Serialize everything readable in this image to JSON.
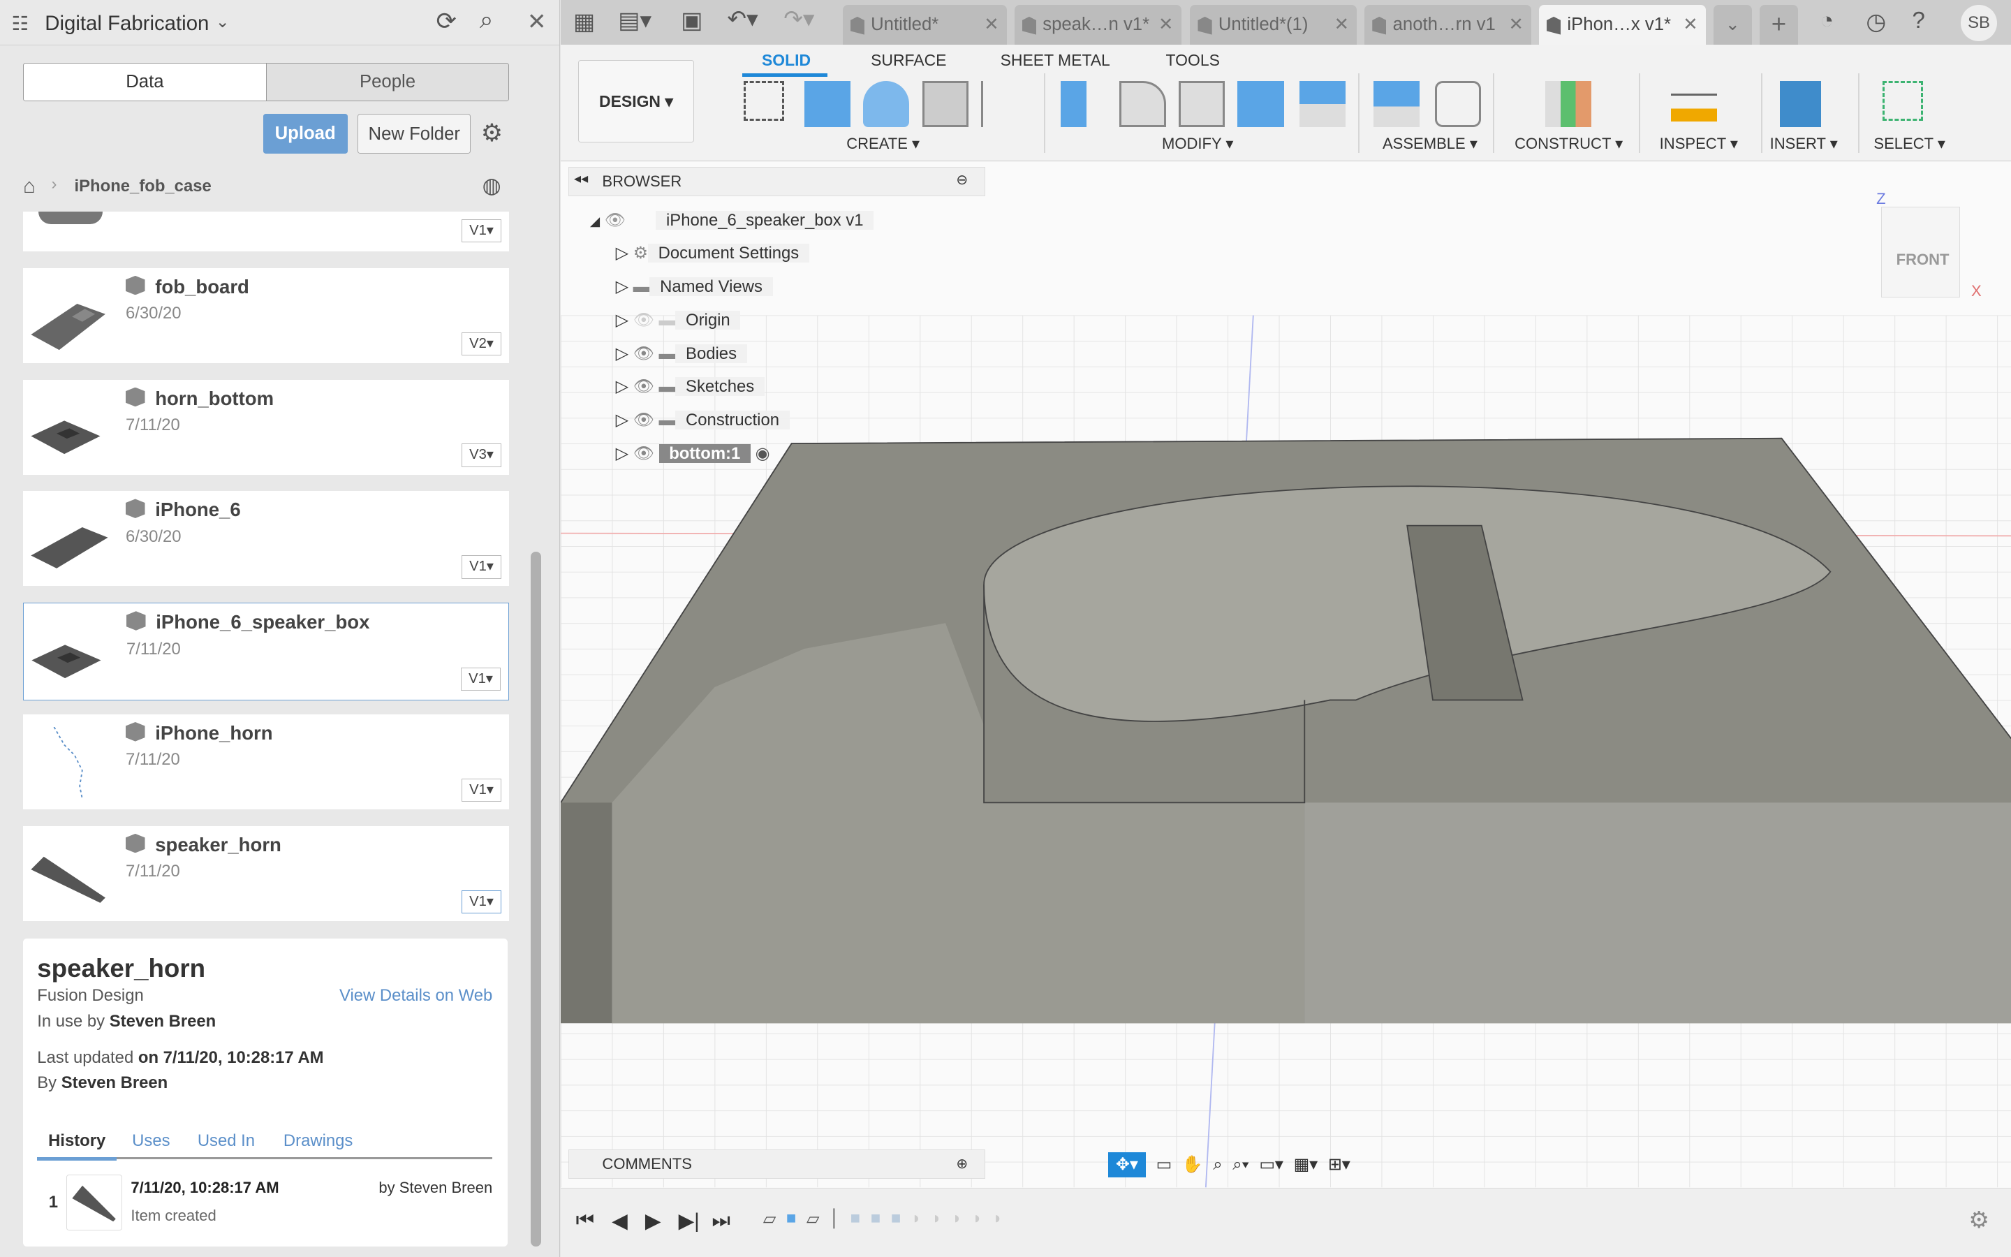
{
  "left_panel": {
    "project_title": "Digital Fabrication",
    "tabs": [
      "Data",
      "People"
    ],
    "upload_label": "Upload",
    "new_folder_label": "New Folder",
    "breadcrumb": "iPhone_fob_case",
    "items": [
      {
        "name": "",
        "date": "",
        "version": "V1"
      },
      {
        "name": "fob_board",
        "date": "6/30/20",
        "version": "V2"
      },
      {
        "name": "horn_bottom",
        "date": "7/11/20",
        "version": "V3"
      },
      {
        "name": "iPhone_6",
        "date": "6/30/20",
        "version": "V1"
      },
      {
        "name": "iPhone_6_speaker_box",
        "date": "7/11/20",
        "version": "V1",
        "selected": true
      },
      {
        "name": "iPhone_horn",
        "date": "7/11/20",
        "version": "V1"
      },
      {
        "name": "speaker_horn",
        "date": "7/11/20",
        "version": "V1"
      }
    ],
    "details": {
      "title": "speaker_horn",
      "type": "Fusion Design",
      "view_link": "View Details on Web",
      "in_use_prefix": "In use by",
      "in_use_by": "Steven Breen",
      "updated_prefix": "Last updated",
      "updated": "on 7/11/20, 10:28:17 AM",
      "by_prefix": "By",
      "by": "Steven Breen",
      "tabs": [
        "History",
        "Uses",
        "Used In",
        "Drawings"
      ],
      "history": [
        {
          "num": "1",
          "date": "7/11/20, 10:28:17 AM",
          "by": "by Steven Breen",
          "desc": "Item created"
        }
      ]
    }
  },
  "doc_tabs": [
    {
      "label": "Untitled*"
    },
    {
      "label": "speak…n v1*"
    },
    {
      "label": "Untitled*(1)"
    },
    {
      "label": "anoth…rn v1"
    },
    {
      "label": "iPhon…x v1*",
      "active": true
    }
  ],
  "user_initials": "SB",
  "ribbon": {
    "workspace": "DESIGN ▾",
    "tabs": [
      "SOLID",
      "SURFACE",
      "SHEET METAL",
      "TOOLS"
    ],
    "active_tab": "SOLID",
    "groups": [
      "CREATE ▾",
      "MODIFY ▾",
      "ASSEMBLE ▾",
      "CONSTRUCT ▾",
      "INSPECT ▾",
      "INSERT ▾",
      "SELECT ▾"
    ]
  },
  "browser": {
    "title": "BROWSER",
    "root": "iPhone_6_speaker_box v1",
    "nodes": [
      "Document Settings",
      "Named Views",
      "Origin",
      "Bodies",
      "Sketches",
      "Construction",
      "bottom:1"
    ]
  },
  "viewcube": {
    "face": "FRONT",
    "axis_z": "Z",
    "axis_x": "X"
  },
  "comments_label": "COMMENTS",
  "colors": {
    "accent": "#1e88d8",
    "upload": "#6b9fd4",
    "link": "#5b8fc9"
  }
}
